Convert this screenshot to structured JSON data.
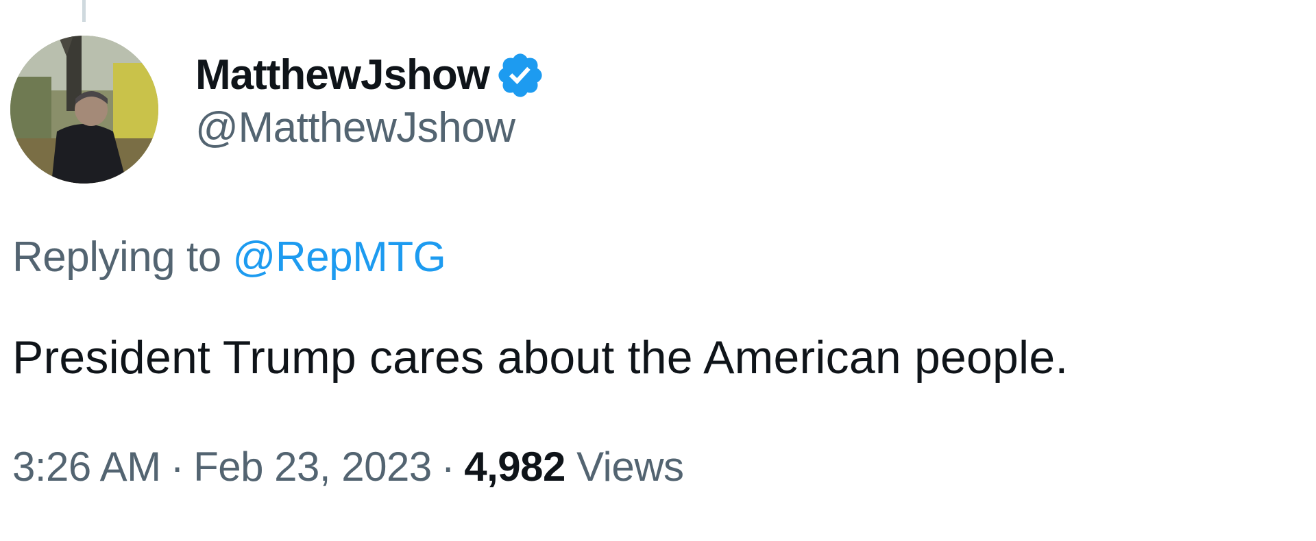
{
  "author": {
    "display_name": "MatthewJshow",
    "handle": "@MatthewJshow",
    "verified": true,
    "avatar_icon": "profile-photo"
  },
  "reply": {
    "prefix": "Replying to",
    "target": "@RepMTG"
  },
  "tweet": {
    "text": "President Trump cares about the American people."
  },
  "meta": {
    "time": "3:26 AM",
    "separator": "·",
    "date": "Feb 23, 2023",
    "views_count": "4,982",
    "views_label": "Views"
  },
  "colors": {
    "primary_text": "#0f1419",
    "secondary_text": "#536471",
    "link": "#1d9bf0",
    "verified_badge": "#1d9bf0",
    "thread_line": "#cfd9de"
  }
}
